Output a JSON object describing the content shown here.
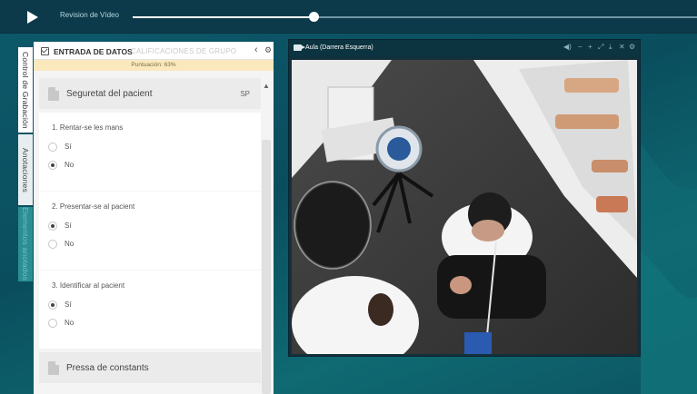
{
  "topbar": {
    "title": "Revision de Vídeo",
    "progress_fraction": 0.32
  },
  "side_tabs": [
    {
      "label": "Control de Grabación"
    },
    {
      "label": "Anotaciones"
    },
    {
      "label": "Elementos anotados"
    }
  ],
  "panel": {
    "title": "ENTRADA DE DATOS",
    "subtitle": "CALIFICACIONES DE GRUPO",
    "score": "Puntuación: 63%",
    "sections": [
      {
        "label": "Seguretat del pacient",
        "badge": "SP"
      },
      {
        "label": "Pressa de constants"
      }
    ],
    "questions": [
      {
        "text": "1.  Rentar-se les mans",
        "options": [
          "Sí",
          "No"
        ],
        "selected": 1
      },
      {
        "text": "2.  Presentar-se al pacient",
        "options": [
          "Sí",
          "No"
        ],
        "selected": 0
      },
      {
        "text": "3.  Identificar al pacient",
        "options": [
          "Sí",
          "No"
        ],
        "selected": 0
      }
    ]
  },
  "video": {
    "title": "Aula (Darrera Esquerra)"
  },
  "colors": {
    "background": "#0d5a6b",
    "topbar": "#0c3a4a",
    "score_bar": "#fbe9bd",
    "active_tab": "#2b8e93"
  }
}
